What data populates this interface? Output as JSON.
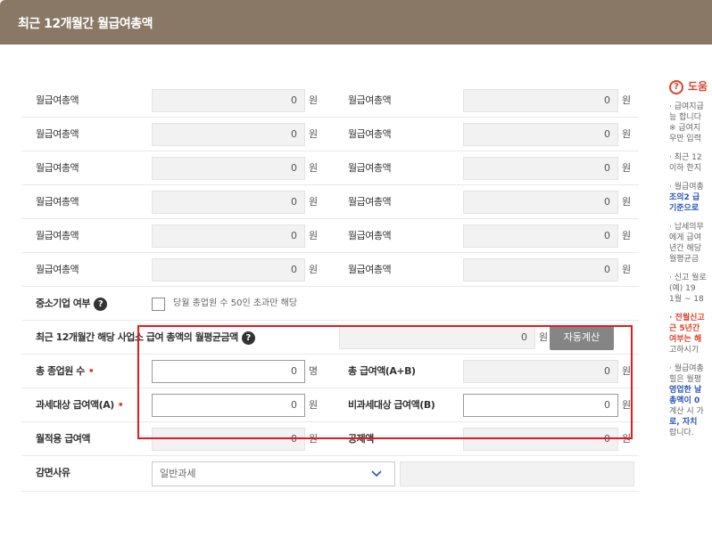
{
  "header": {
    "title": "최근 12개월간 월급여총액"
  },
  "monthly": {
    "label": "월급여총액",
    "unit": "원",
    "rows": [
      {
        "left": "0",
        "right": "0"
      },
      {
        "left": "0",
        "right": "0"
      },
      {
        "left": "0",
        "right": "0"
      },
      {
        "left": "0",
        "right": "0"
      },
      {
        "left": "0",
        "right": "0"
      },
      {
        "left": "0",
        "right": "0"
      }
    ]
  },
  "sme": {
    "label": "중소기업 여부",
    "checkbox_label": "당월 종업원 수 50인 초과만 해당"
  },
  "average": {
    "label": "최근 12개월간 해당 사업소 급여 총액의 월평균금액",
    "value": "0",
    "unit": "원",
    "button": "자동계산"
  },
  "employees": {
    "label": "총 종업원 수",
    "value": "0",
    "unit": "명"
  },
  "total_pay": {
    "label": "총 급여액(A+B)",
    "value": "0",
    "unit": "원"
  },
  "taxable": {
    "label": "과세대상 급여액(A)",
    "value": "0",
    "unit": "원"
  },
  "nontaxable": {
    "label": "비과세대상 급여액(B)",
    "value": "0",
    "unit": "원"
  },
  "applied": {
    "label": "월적용 급여액",
    "value": "0",
    "unit": "원"
  },
  "deduction": {
    "label": "공제액",
    "value": "0",
    "unit": "원"
  },
  "reduction": {
    "label": "감면사유",
    "selected": "일반과세"
  },
  "req_mark": "•",
  "help": {
    "title": "도움",
    "lines": [
      [
        "· 급여지급",
        "능 합니다",
        "※ 급여지",
        "우만 입력"
      ],
      [
        "· 최근 12",
        "이하 한지"
      ],
      [
        "· 월급여총",
        "조의2 급",
        "기준으로"
      ],
      [
        "· 납세의무",
        "에게 급여",
        "년간 해당",
        "월평균금"
      ],
      [
        "· 신고 월로",
        "(예) 19",
        "1월 ~ 18"
      ],
      [
        "· 전월신고",
        "근 5년간",
        "여부는 해",
        "고하시기"
      ],
      [
        "· 월급여총",
        "힐은 월평",
        "영업한 날",
        "총액이 0",
        "계산 시 가",
        "로, 자치",
        "랍니다."
      ]
    ]
  },
  "colors": {
    "header_bg": "#897865",
    "accent_red": "#e0412b",
    "highlight": "#e8191b",
    "button_bg": "#858585"
  }
}
